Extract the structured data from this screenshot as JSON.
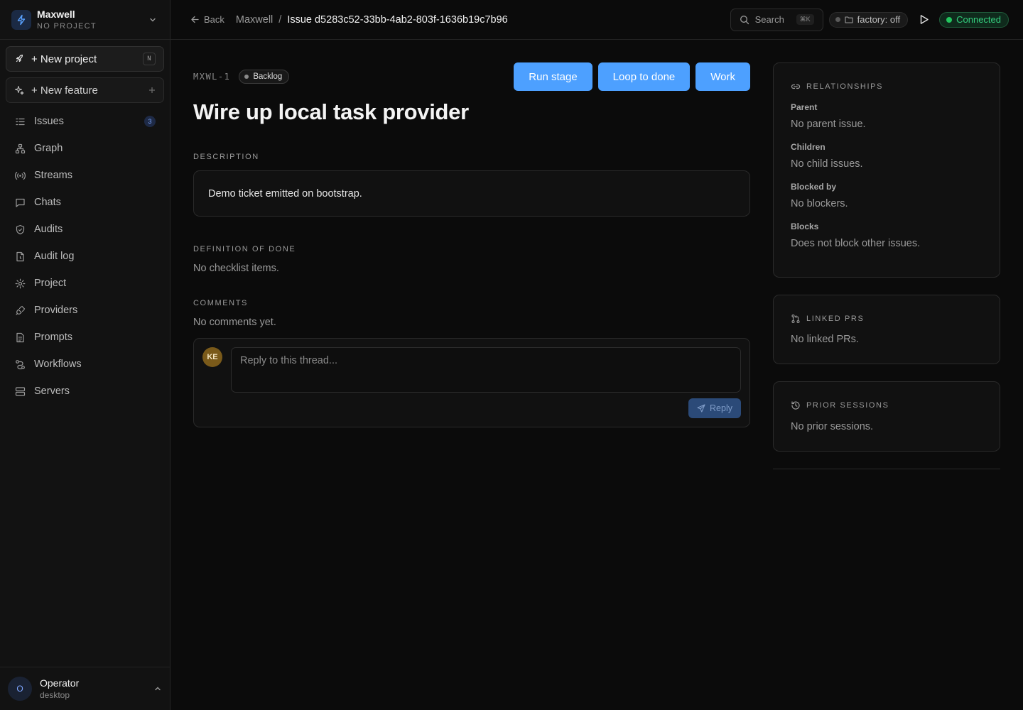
{
  "workspace": {
    "name": "Maxwell",
    "subtitle": "NO PROJECT"
  },
  "sidebar": {
    "new_project": {
      "label": "+ New project",
      "shortcut": "N"
    },
    "new_feature": {
      "label": "+ New feature"
    },
    "items": [
      {
        "label": "Issues",
        "icon": "issues-icon",
        "count": "3"
      },
      {
        "label": "Graph",
        "icon": "graph-icon"
      },
      {
        "label": "Streams",
        "icon": "streams-icon"
      },
      {
        "label": "Chats",
        "icon": "chat-icon"
      },
      {
        "label": "Audits",
        "icon": "shield-icon"
      },
      {
        "label": "Audit log",
        "icon": "file-icon"
      },
      {
        "label": "Project",
        "icon": "gear-icon"
      },
      {
        "label": "Providers",
        "icon": "plug-icon"
      },
      {
        "label": "Prompts",
        "icon": "document-icon"
      },
      {
        "label": "Workflows",
        "icon": "workflow-icon"
      },
      {
        "label": "Servers",
        "icon": "server-icon"
      }
    ]
  },
  "user": {
    "initial": "O",
    "name": "Operator",
    "subtitle": "desktop"
  },
  "topbar": {
    "back_label": "Back",
    "breadcrumb_root": "Maxwell",
    "breadcrumb_sep": "/",
    "breadcrumb_current": "Issue d5283c52-33bb-4ab2-803f-1636b19c7b96",
    "search_label": "Search",
    "search_shortcut": "⌘K",
    "factory_label": "factory: off",
    "connection_label": "Connected"
  },
  "issue": {
    "key": "MXWL-1",
    "status": "Backlog",
    "actions": {
      "run_stage": "Run stage",
      "loop_to_done": "Loop to done",
      "work": "Work"
    },
    "title": "Wire up local task provider",
    "description_heading": "DESCRIPTION",
    "description": "Demo ticket emitted on bootstrap.",
    "dod_heading": "DEFINITION OF DONE",
    "dod_empty": "No checklist items.",
    "comments_heading": "COMMENTS",
    "comments_empty": "No comments yet.",
    "comment_avatar": "KE",
    "comment_placeholder": "Reply to this thread...",
    "reply_label": "Reply"
  },
  "relationships": {
    "heading": "RELATIONSHIPS",
    "parent_label": "Parent",
    "parent_value": "No parent issue.",
    "children_label": "Children",
    "children_value": "No child issues.",
    "blocked_by_label": "Blocked by",
    "blocked_by_value": "No blockers.",
    "blocks_label": "Blocks",
    "blocks_value": "Does not block other issues."
  },
  "linked_prs": {
    "heading": "LINKED PRS",
    "empty": "No linked PRs."
  },
  "prior_sessions": {
    "heading": "PRIOR SESSIONS",
    "empty": "No prior sessions."
  },
  "colors": {
    "accent": "#4da0ff",
    "connected": "#22c55e",
    "background": "#0b0b0b",
    "sidebar": "#121212"
  }
}
